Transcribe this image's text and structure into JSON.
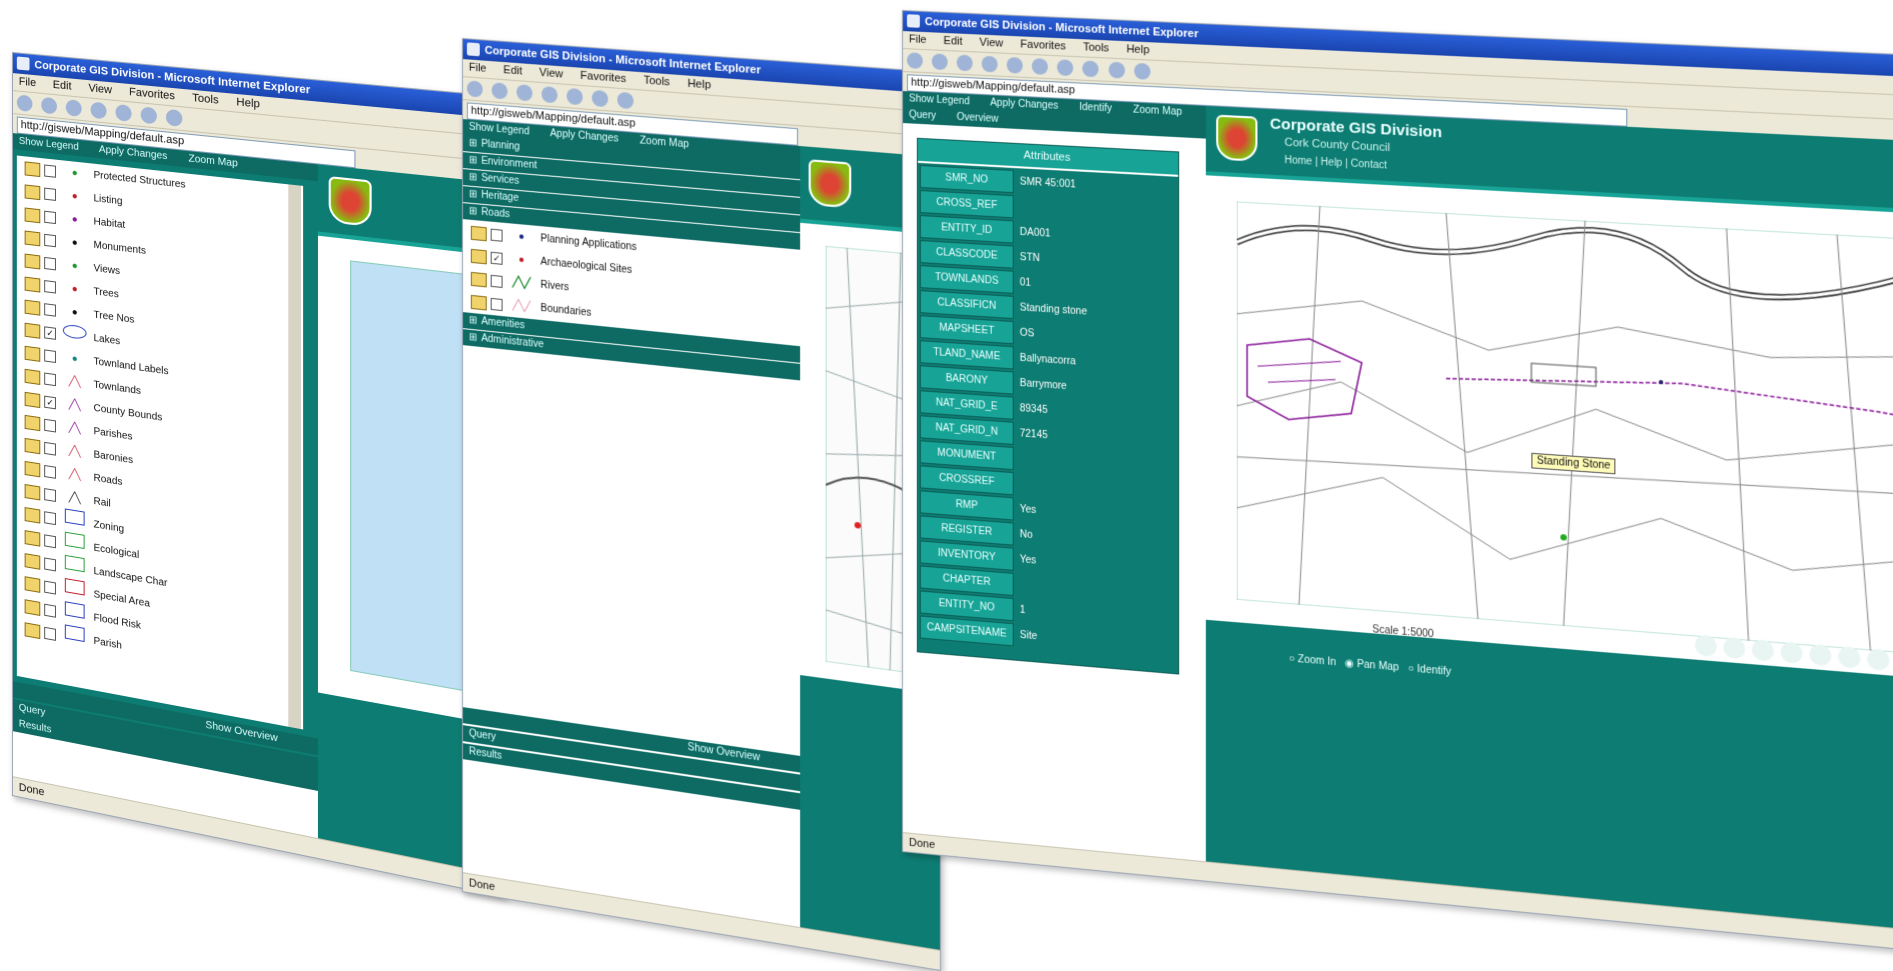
{
  "colors": {
    "teal_dark": "#0d6b63",
    "teal": "#0d7c72",
    "teal_light": "#17a396",
    "xp_title": "#2a5fd8",
    "xp_chrome": "#ece9d8",
    "map_water": "#bfe0f5"
  },
  "windows": [
    {
      "title": "Corporate GIS Division - Microsoft Internet Explorer",
      "menu": [
        "File",
        "Edit",
        "View",
        "Favorites",
        "Tools",
        "Help"
      ],
      "address": "http://gisweb/Mapping/default.asp",
      "panel_tabs": [
        "Show Legend",
        "Apply Changes",
        "Zoom Map"
      ],
      "layers": [
        {
          "label": "Protected Structures",
          "checked": false,
          "symbol": "dot-green"
        },
        {
          "label": "Listing",
          "checked": false,
          "symbol": "dot-red"
        },
        {
          "label": "Habitat",
          "checked": false,
          "symbol": "dot-purple"
        },
        {
          "label": "Monuments",
          "checked": false,
          "symbol": "dot-black"
        },
        {
          "label": "Views",
          "checked": false,
          "symbol": "dot-green"
        },
        {
          "label": "Trees",
          "checked": false,
          "symbol": "dot-red"
        },
        {
          "label": "Tree Nos",
          "checked": false,
          "symbol": "dot-black"
        },
        {
          "label": "Lakes",
          "checked": true,
          "symbol": "ellipse-blue"
        },
        {
          "label": "Townland Labels",
          "checked": false,
          "symbol": "dot-teal"
        },
        {
          "label": "Townlands",
          "checked": false,
          "symbol": "line-red"
        },
        {
          "label": "County Bounds",
          "checked": true,
          "symbol": "line-purple"
        },
        {
          "label": "Parishes",
          "checked": false,
          "symbol": "line-purple"
        },
        {
          "label": "Baronies",
          "checked": false,
          "symbol": "line-red"
        },
        {
          "label": "Roads",
          "checked": false,
          "symbol": "line-red"
        },
        {
          "label": "Rail",
          "checked": false,
          "symbol": "line-black"
        },
        {
          "label": "Zoning",
          "checked": false,
          "symbol": "box-blue"
        },
        {
          "label": "Ecological",
          "checked": false,
          "symbol": "box-green"
        },
        {
          "label": "Landscape Char",
          "checked": false,
          "symbol": "box-green"
        },
        {
          "label": "Special Area",
          "checked": false,
          "symbol": "box-red"
        },
        {
          "label": "Flood Risk",
          "checked": false,
          "symbol": "box-blue"
        },
        {
          "label": "Parish",
          "checked": false,
          "symbol": "box-blue"
        }
      ],
      "panel_footer": "Show Overview",
      "query_labels": [
        "Query",
        "Results"
      ],
      "status": "Done"
    },
    {
      "title": "Corporate GIS Division - Microsoft Internet Explorer",
      "menu": [
        "File",
        "Edit",
        "View",
        "Favorites",
        "Tools",
        "Help"
      ],
      "address": "http://gisweb/Mapping/default.asp",
      "panel_tabs": [
        "Show Legend",
        "Apply Changes",
        "Zoom Map"
      ],
      "groups_top": [
        "Planning",
        "Environment",
        "Services",
        "Heritage",
        "Roads"
      ],
      "layers": [
        {
          "label": "Planning Applications",
          "checked": false,
          "symbol": "dot-navy"
        },
        {
          "label": "Archaeological Sites",
          "checked": true,
          "symbol": "dot-red"
        },
        {
          "label": "Rivers",
          "checked": false,
          "symbol": "line-green"
        },
        {
          "label": "Boundaries",
          "checked": false,
          "symbol": "line-pink"
        }
      ],
      "groups_bottom": [
        "Amenities",
        "Administrative"
      ],
      "panel_footer": "Show Overview",
      "query_labels": [
        "Query",
        "Results"
      ],
      "status": "Done"
    },
    {
      "title": "Corporate GIS Division - Microsoft Internet Explorer",
      "menu": [
        "File",
        "Edit",
        "View",
        "Favorites",
        "Tools",
        "Help"
      ],
      "address": "http://gisweb/Mapping/default.asp",
      "panel_tabs": [
        "Show Legend",
        "Apply Changes",
        "Identify",
        "Zoom Map",
        "Query",
        "Overview"
      ],
      "attributes_title": "Attributes",
      "attributes": [
        {
          "key": "SMR_NO",
          "value": "SMR 45:001"
        },
        {
          "key": "CROSS_REF",
          "value": ""
        },
        {
          "key": "ENTITY_ID",
          "value": "DA001"
        },
        {
          "key": "CLASSCODE",
          "value": "STN"
        },
        {
          "key": "TOWNLANDS",
          "value": "01"
        },
        {
          "key": "CLASSIFICN",
          "value": "Standing stone"
        },
        {
          "key": "MAPSHEET",
          "value": "OS"
        },
        {
          "key": "TLAND_NAME",
          "value": "Ballynacorra"
        },
        {
          "key": "BARONY",
          "value": "Barrymore"
        },
        {
          "key": "NAT_GRID_E",
          "value": "89345"
        },
        {
          "key": "NAT_GRID_N",
          "value": "72145"
        },
        {
          "key": "MONUMENT",
          "value": ""
        },
        {
          "key": "CROSSREF",
          "value": ""
        },
        {
          "key": "RMP",
          "value": "Yes"
        },
        {
          "key": "REGISTER",
          "value": "No"
        },
        {
          "key": "INVENTORY",
          "value": "Yes"
        },
        {
          "key": "CHAPTER",
          "value": ""
        },
        {
          "key": "ENTITY_NO",
          "value": "1"
        },
        {
          "key": "CAMPSITENAME",
          "value": "Site"
        }
      ],
      "header_title": "Corporate GIS Division",
      "header_subtitle": "Cork County Council",
      "header_links": [
        "Home",
        "Help",
        "Contact"
      ],
      "map_label": "Standing Stone",
      "scale_text": "Scale 1:5000",
      "bottom_options": [
        "Zoom In",
        "Pan Map",
        "Identify"
      ],
      "status": "Done"
    }
  ]
}
